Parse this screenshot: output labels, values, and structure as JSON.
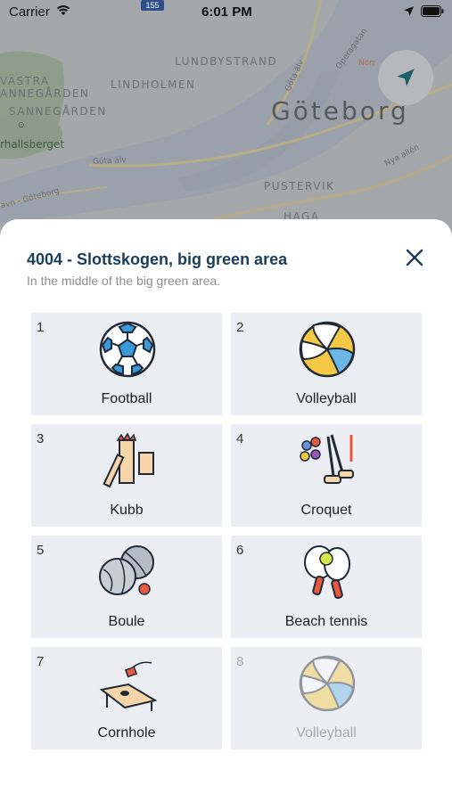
{
  "status_bar": {
    "carrier": "Carrier",
    "time": "6:01 PM"
  },
  "map": {
    "city": "Göteborg",
    "districts": [
      "VÄSTRA",
      "ANNEGÅRDEN",
      "SANNEGÅRDEN",
      "LINDHOLMEN",
      "LUNDBYSTRAND",
      "PUSTERVIK",
      "HAGA"
    ],
    "park_label": "rhallsberget",
    "road_labels": [
      "Göta älv",
      "Göta älv",
      "Operagatan",
      "Nya allén",
      "avn - Göteborg"
    ],
    "road_sign": "155",
    "poi_label": "Norr",
    "locate_icon": "navigation-arrow-icon"
  },
  "sheet": {
    "title": "4004 - Slottskogen, big green area",
    "subtitle": "In the middle of the big green area.",
    "close_icon": "close-icon"
  },
  "items": [
    {
      "num": "1",
      "name": "Football",
      "icon": "football-icon",
      "enabled": true
    },
    {
      "num": "2",
      "name": "Volleyball",
      "icon": "volleyball-icon",
      "enabled": true
    },
    {
      "num": "3",
      "name": "Kubb",
      "icon": "kubb-icon",
      "enabled": true
    },
    {
      "num": "4",
      "name": "Croquet",
      "icon": "croquet-icon",
      "enabled": true
    },
    {
      "num": "5",
      "name": "Boule",
      "icon": "boule-icon",
      "enabled": true
    },
    {
      "num": "6",
      "name": "Beach tennis",
      "icon": "beach-tennis-icon",
      "enabled": true
    },
    {
      "num": "7",
      "name": "Cornhole",
      "icon": "cornhole-icon",
      "enabled": true
    },
    {
      "num": "8",
      "name": "Volleyball",
      "icon": "volleyball-icon",
      "enabled": false
    }
  ]
}
